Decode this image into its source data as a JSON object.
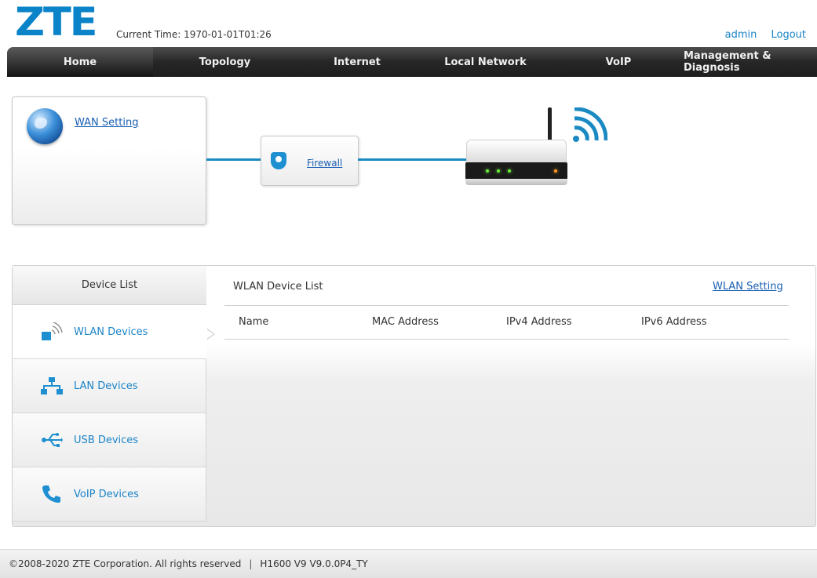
{
  "header": {
    "logo_text": "ZTE",
    "current_time_label": "Current Time:",
    "current_time_value": "1970-01-01T01:26",
    "user": "admin",
    "logout": "Logout"
  },
  "nav": {
    "items": [
      {
        "label": "Home",
        "active": true
      },
      {
        "label": "Topology"
      },
      {
        "label": "Internet"
      },
      {
        "label": "Local Network"
      },
      {
        "label": "VoIP"
      },
      {
        "label": "Management & Diagnosis"
      }
    ]
  },
  "topology": {
    "wan_setting": "WAN Setting",
    "firewall": "Firewall",
    "accent_color": "#1b8ac2"
  },
  "device_list": {
    "title": "Device List",
    "items": [
      {
        "label": "WLAN Devices",
        "icon": "wlan-device-icon",
        "active": true
      },
      {
        "label": "LAN Devices",
        "icon": "lan-network-icon"
      },
      {
        "label": "USB Devices",
        "icon": "usb-icon"
      },
      {
        "label": "VoIP Devices",
        "icon": "phone-icon"
      }
    ]
  },
  "wlan_list": {
    "title": "WLAN Device List",
    "setting_link": "WLAN Setting",
    "columns": [
      "Name",
      "MAC Address",
      "IPv4 Address",
      "IPv6 Address"
    ],
    "rows": []
  },
  "footer": {
    "copyright": "©2008-2020 ZTE Corporation. All rights reserved",
    "separator": "|",
    "version": "H1600 V9 V9.0.0P4_TY"
  }
}
